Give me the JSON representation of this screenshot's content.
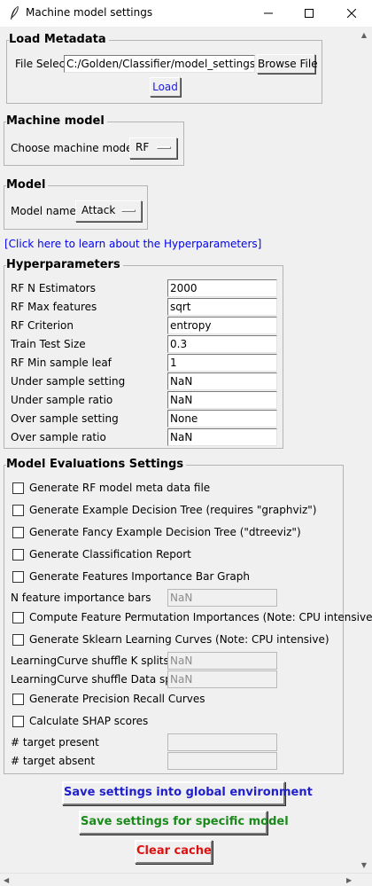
{
  "window": {
    "title": "Machine model settings",
    "min_glyph": "—",
    "max_glyph": "☐",
    "close_glyph": "✕"
  },
  "load_metadata": {
    "title": "Load Metadata",
    "file_select_label": "File Select",
    "file_path": "C:/Golden/Classifier/model_settings.csv",
    "browse_label": "Browse File",
    "load_label": "Load"
  },
  "machine_model": {
    "title": "Machine model",
    "choose_label": "Choose machine model:",
    "selected": "RF"
  },
  "model": {
    "title": "Model",
    "name_label": "Model name",
    "selected": "Attack"
  },
  "hyperparam_link": "[Click here to learn about the Hyperparameters]",
  "hyperparameters": {
    "title": "Hyperparameters",
    "rows": [
      {
        "label": "RF N Estimators",
        "value": "2000"
      },
      {
        "label": "RF Max features",
        "value": "sqrt"
      },
      {
        "label": "RF Criterion",
        "value": "entropy"
      },
      {
        "label": "Train Test Size",
        "value": "0.3"
      },
      {
        "label": "RF Min sample leaf",
        "value": "1"
      },
      {
        "label": "Under sample setting",
        "value": "NaN"
      },
      {
        "label": "Under sample ratio",
        "value": "NaN"
      },
      {
        "label": "Over sample setting",
        "value": "None"
      },
      {
        "label": "Over sample ratio",
        "value": "NaN"
      }
    ]
  },
  "evaluations": {
    "title": "Model Evaluations Settings",
    "cb_meta": "Generate RF model meta data file",
    "cb_tree": "Generate Example Decision Tree (requires \"graphviz\")",
    "cb_fancy_tree": "Generate Fancy Example Decision Tree (\"dtreeviz\")",
    "cb_report": "Generate Classification Report",
    "cb_importance": "Generate Features Importance Bar Graph",
    "n_feature_label": "N feature importance bars",
    "n_feature_value": "NaN",
    "cb_permutation": "Compute Feature Permutation Importances (Note: CPU intensive)",
    "cb_learning": "Generate Sklearn Learning Curves (Note: CPU intensive)",
    "lc_k_label": "LearningCurve shuffle K splits",
    "lc_k_value": "NaN",
    "lc_data_label": "LearningCurve shuffle Data splits",
    "lc_data_value": "NaN",
    "cb_pr": "Generate Precision Recall Curves",
    "cb_shap": "Calculate SHAP scores",
    "target_present_label": "# target present",
    "target_present_value": "",
    "target_absent_label": "# target absent",
    "target_absent_value": ""
  },
  "actions": {
    "save_global": "Save settings into global environment",
    "save_specific": "Save settings for specific model",
    "clear_cache": "Clear cache"
  },
  "colors": {
    "link": "#0000ee",
    "save_global": "#1f1fcc",
    "save_specific": "#1a8a1a",
    "clear_cache": "#e01010"
  }
}
